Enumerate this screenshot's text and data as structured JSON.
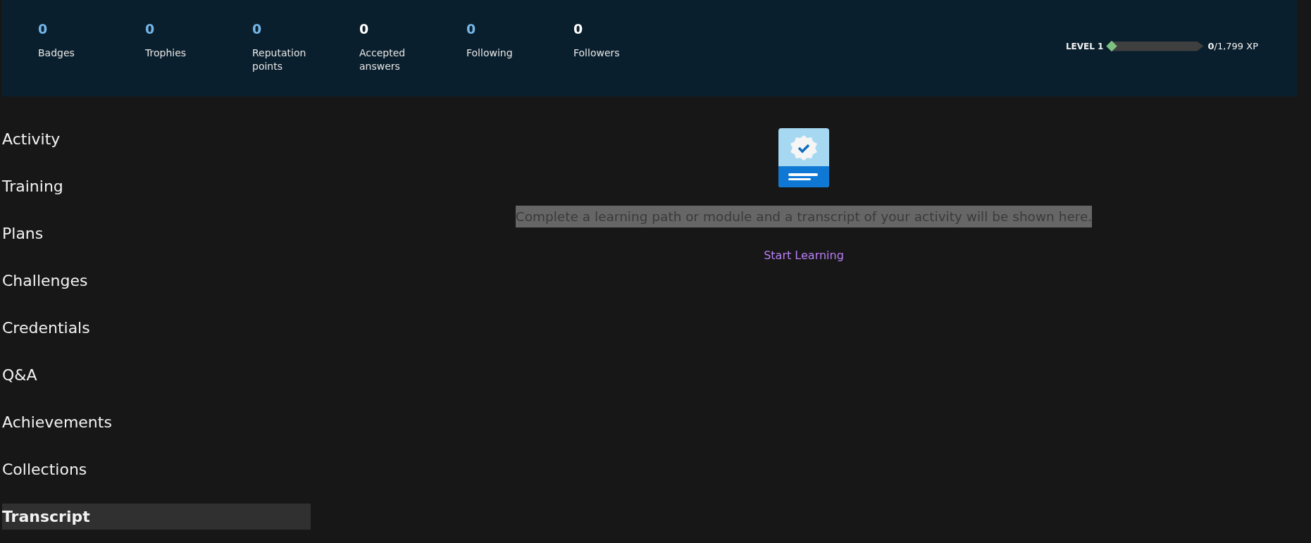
{
  "stats": [
    {
      "value": "0",
      "label": "Badges",
      "color": "#75b6e7"
    },
    {
      "value": "0",
      "label": "Trophies",
      "color": "#75b6e7"
    },
    {
      "value": "0",
      "label": "Reputation points",
      "color": "#75b6e7"
    },
    {
      "value": "0",
      "label": "Accepted answers",
      "color": "#ffffff"
    },
    {
      "value": "0",
      "label": "Following",
      "color": "#75b6e7"
    },
    {
      "value": "0",
      "label": "Followers",
      "color": "#ffffff"
    }
  ],
  "level": {
    "label": "LEVEL 1",
    "level": 0,
    "earned": "0",
    "total": "/1,799 XP"
  },
  "sidebar": {
    "items": [
      {
        "label": "Activity",
        "selected": false
      },
      {
        "label": "Training",
        "selected": false
      },
      {
        "label": "Plans",
        "selected": false
      },
      {
        "label": "Challenges",
        "selected": false
      },
      {
        "label": "Credentials",
        "selected": false
      },
      {
        "label": "Q&A",
        "selected": false
      },
      {
        "label": "Achievements",
        "selected": false
      },
      {
        "label": "Collections",
        "selected": false
      },
      {
        "label": "Transcript",
        "selected": true
      }
    ]
  },
  "empty_state": {
    "message": "Complete a learning path or module and a transcript of your activity will be shown here.",
    "link": "Start Learning"
  }
}
